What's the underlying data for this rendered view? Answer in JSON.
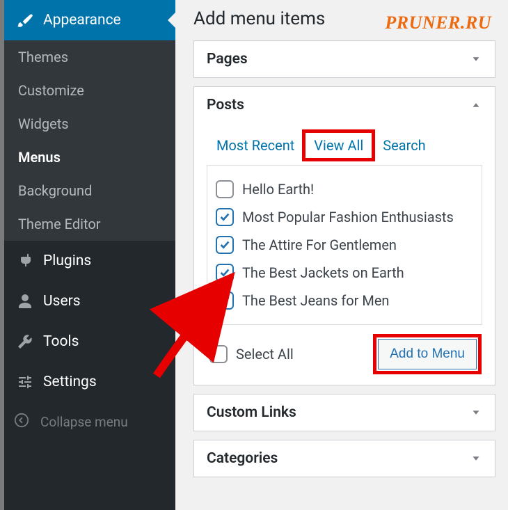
{
  "sidebar": {
    "appearance_label": "Appearance",
    "submenu": [
      "Themes",
      "Customize",
      "Widgets",
      "Menus",
      "Background",
      "Theme Editor"
    ],
    "submenu_current": "Menus",
    "plugins": "Plugins",
    "users": "Users",
    "tools": "Tools",
    "settings": "Settings",
    "collapse": "Collapse menu"
  },
  "main": {
    "title": "Add menu items",
    "watermark": "PRUNER.RU",
    "sections": {
      "pages": "Pages",
      "posts": "Posts",
      "custom_links": "Custom Links",
      "categories": "Categories"
    },
    "posts": {
      "tabs": {
        "recent": "Most Recent",
        "all": "View All",
        "search": "Search"
      },
      "items": [
        {
          "label": "Hello Earth!",
          "checked": false
        },
        {
          "label": "Most Popular Fashion Enthusiasts",
          "checked": true
        },
        {
          "label": "The Attire For Gentlemen",
          "checked": true
        },
        {
          "label": "The Best Jackets on Earth",
          "checked": true
        },
        {
          "label": "The Best Jeans for Men",
          "checked": true
        }
      ],
      "select_all": "Select All",
      "add_button": "Add to Menu"
    }
  }
}
